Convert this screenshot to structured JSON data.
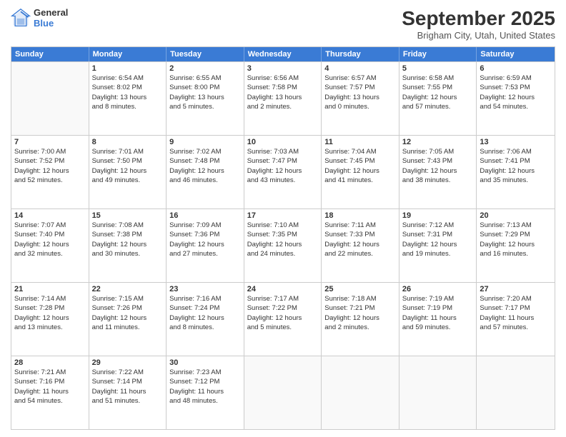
{
  "header": {
    "logo_line1": "General",
    "logo_line2": "Blue",
    "main_title": "September 2025",
    "sub_title": "Brigham City, Utah, United States"
  },
  "days_of_week": [
    "Sunday",
    "Monday",
    "Tuesday",
    "Wednesday",
    "Thursday",
    "Friday",
    "Saturday"
  ],
  "weeks": [
    [
      {
        "day": "",
        "info": ""
      },
      {
        "day": "1",
        "info": "Sunrise: 6:54 AM\nSunset: 8:02 PM\nDaylight: 13 hours\nand 8 minutes."
      },
      {
        "day": "2",
        "info": "Sunrise: 6:55 AM\nSunset: 8:00 PM\nDaylight: 13 hours\nand 5 minutes."
      },
      {
        "day": "3",
        "info": "Sunrise: 6:56 AM\nSunset: 7:58 PM\nDaylight: 13 hours\nand 2 minutes."
      },
      {
        "day": "4",
        "info": "Sunrise: 6:57 AM\nSunset: 7:57 PM\nDaylight: 13 hours\nand 0 minutes."
      },
      {
        "day": "5",
        "info": "Sunrise: 6:58 AM\nSunset: 7:55 PM\nDaylight: 12 hours\nand 57 minutes."
      },
      {
        "day": "6",
        "info": "Sunrise: 6:59 AM\nSunset: 7:53 PM\nDaylight: 12 hours\nand 54 minutes."
      }
    ],
    [
      {
        "day": "7",
        "info": "Sunrise: 7:00 AM\nSunset: 7:52 PM\nDaylight: 12 hours\nand 52 minutes."
      },
      {
        "day": "8",
        "info": "Sunrise: 7:01 AM\nSunset: 7:50 PM\nDaylight: 12 hours\nand 49 minutes."
      },
      {
        "day": "9",
        "info": "Sunrise: 7:02 AM\nSunset: 7:48 PM\nDaylight: 12 hours\nand 46 minutes."
      },
      {
        "day": "10",
        "info": "Sunrise: 7:03 AM\nSunset: 7:47 PM\nDaylight: 12 hours\nand 43 minutes."
      },
      {
        "day": "11",
        "info": "Sunrise: 7:04 AM\nSunset: 7:45 PM\nDaylight: 12 hours\nand 41 minutes."
      },
      {
        "day": "12",
        "info": "Sunrise: 7:05 AM\nSunset: 7:43 PM\nDaylight: 12 hours\nand 38 minutes."
      },
      {
        "day": "13",
        "info": "Sunrise: 7:06 AM\nSunset: 7:41 PM\nDaylight: 12 hours\nand 35 minutes."
      }
    ],
    [
      {
        "day": "14",
        "info": "Sunrise: 7:07 AM\nSunset: 7:40 PM\nDaylight: 12 hours\nand 32 minutes."
      },
      {
        "day": "15",
        "info": "Sunrise: 7:08 AM\nSunset: 7:38 PM\nDaylight: 12 hours\nand 30 minutes."
      },
      {
        "day": "16",
        "info": "Sunrise: 7:09 AM\nSunset: 7:36 PM\nDaylight: 12 hours\nand 27 minutes."
      },
      {
        "day": "17",
        "info": "Sunrise: 7:10 AM\nSunset: 7:35 PM\nDaylight: 12 hours\nand 24 minutes."
      },
      {
        "day": "18",
        "info": "Sunrise: 7:11 AM\nSunset: 7:33 PM\nDaylight: 12 hours\nand 22 minutes."
      },
      {
        "day": "19",
        "info": "Sunrise: 7:12 AM\nSunset: 7:31 PM\nDaylight: 12 hours\nand 19 minutes."
      },
      {
        "day": "20",
        "info": "Sunrise: 7:13 AM\nSunset: 7:29 PM\nDaylight: 12 hours\nand 16 minutes."
      }
    ],
    [
      {
        "day": "21",
        "info": "Sunrise: 7:14 AM\nSunset: 7:28 PM\nDaylight: 12 hours\nand 13 minutes."
      },
      {
        "day": "22",
        "info": "Sunrise: 7:15 AM\nSunset: 7:26 PM\nDaylight: 12 hours\nand 11 minutes."
      },
      {
        "day": "23",
        "info": "Sunrise: 7:16 AM\nSunset: 7:24 PM\nDaylight: 12 hours\nand 8 minutes."
      },
      {
        "day": "24",
        "info": "Sunrise: 7:17 AM\nSunset: 7:22 PM\nDaylight: 12 hours\nand 5 minutes."
      },
      {
        "day": "25",
        "info": "Sunrise: 7:18 AM\nSunset: 7:21 PM\nDaylight: 12 hours\nand 2 minutes."
      },
      {
        "day": "26",
        "info": "Sunrise: 7:19 AM\nSunset: 7:19 PM\nDaylight: 11 hours\nand 59 minutes."
      },
      {
        "day": "27",
        "info": "Sunrise: 7:20 AM\nSunset: 7:17 PM\nDaylight: 11 hours\nand 57 minutes."
      }
    ],
    [
      {
        "day": "28",
        "info": "Sunrise: 7:21 AM\nSunset: 7:16 PM\nDaylight: 11 hours\nand 54 minutes."
      },
      {
        "day": "29",
        "info": "Sunrise: 7:22 AM\nSunset: 7:14 PM\nDaylight: 11 hours\nand 51 minutes."
      },
      {
        "day": "30",
        "info": "Sunrise: 7:23 AM\nSunset: 7:12 PM\nDaylight: 11 hours\nand 48 minutes."
      },
      {
        "day": "",
        "info": ""
      },
      {
        "day": "",
        "info": ""
      },
      {
        "day": "",
        "info": ""
      },
      {
        "day": "",
        "info": ""
      }
    ]
  ]
}
